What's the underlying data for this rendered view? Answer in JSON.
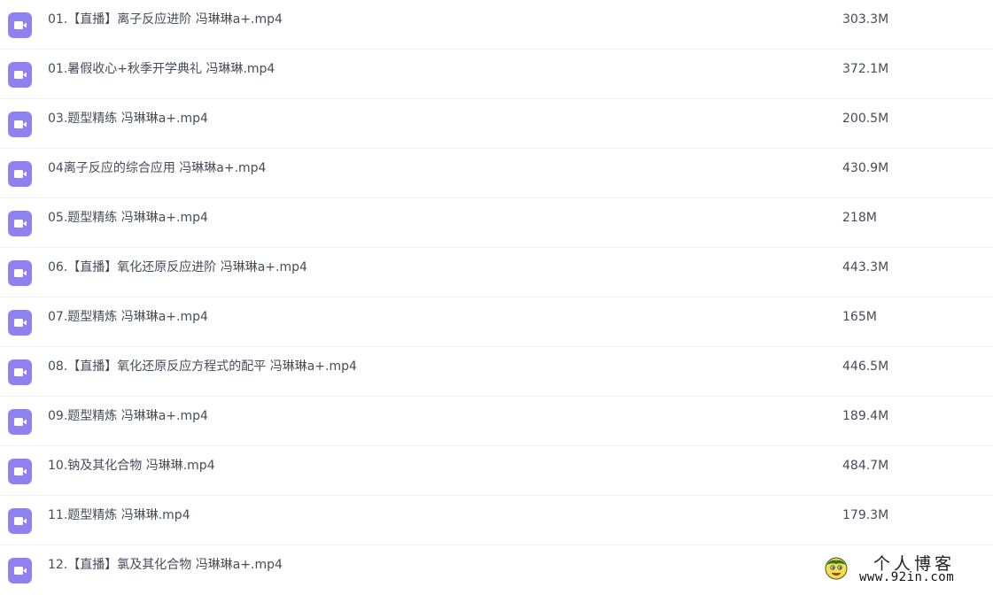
{
  "colors": {
    "icon_background": "#8f82f0",
    "icon_glyph": "#ffffff",
    "text": "#454d5a",
    "row_divider": "#f1f2f5"
  },
  "icon_semantic": "video-file-icon",
  "files": [
    {
      "name": "01.【直播】离子反应进阶 冯琳琳a+.mp4",
      "size": "303.3M"
    },
    {
      "name": "01.暑假收心+秋季开学典礼 冯琳琳.mp4",
      "size": "372.1M"
    },
    {
      "name": "03.题型精练 冯琳琳a+.mp4",
      "size": "200.5M"
    },
    {
      "name": "04离子反应的综合应用 冯琳琳a+.mp4",
      "size": "430.9M"
    },
    {
      "name": "05.题型精练 冯琳琳a+.mp4",
      "size": "218M"
    },
    {
      "name": "06.【直播】氧化还原反应进阶 冯琳琳a+.mp4",
      "size": "443.3M"
    },
    {
      "name": "07.题型精炼 冯琳琳a+.mp4",
      "size": "165M"
    },
    {
      "name": "08.【直播】氧化还原反应方程式的配平 冯琳琳a+.mp4",
      "size": "446.5M"
    },
    {
      "name": "09.题型精炼 冯琳琳a+.mp4",
      "size": "189.4M"
    },
    {
      "name": "10.钠及其化合物 冯琳琳.mp4",
      "size": "484.7M"
    },
    {
      "name": "11.题型精炼 冯琳琳.mp4",
      "size": "179.3M"
    },
    {
      "name": "12.【直播】氯及其化合物 冯琳琳a+.mp4",
      "size": ""
    }
  ],
  "watermark": {
    "title": "个人博客",
    "url": "www.92in.com"
  }
}
